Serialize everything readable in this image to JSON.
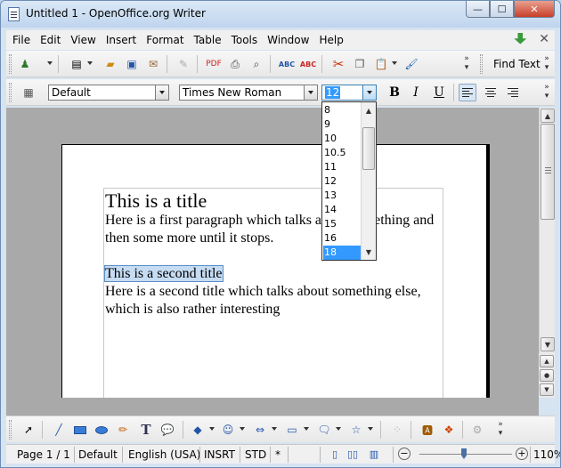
{
  "window": {
    "title": "Untitled 1 - OpenOffice.org Writer",
    "min_label": "—",
    "max_label": "☐",
    "close_label": "✕"
  },
  "menubar": {
    "items": [
      "File",
      "Edit",
      "View",
      "Insert",
      "Format",
      "Table",
      "Tools",
      "Window",
      "Help"
    ]
  },
  "toolbar": {
    "find_text": "Find Text",
    "icons": [
      "navigator-icon",
      "new-icon",
      "open-icon",
      "save-icon",
      "email-icon",
      "edit-file-icon",
      "export-pdf-icon",
      "print-icon",
      "page-preview-icon",
      "spellcheck-icon",
      "autospellcheck-icon",
      "cut-icon",
      "copy-icon",
      "paste-icon",
      "format-paintbrush-icon"
    ]
  },
  "formatting": {
    "style": "Default",
    "font": "Times New Roman",
    "size": "12",
    "bold": "B",
    "italic": "I",
    "underline": "U",
    "align": "left"
  },
  "font_size_list": {
    "options": [
      "8",
      "9",
      "10",
      "10.5",
      "11",
      "12",
      "13",
      "14",
      "15",
      "16",
      "18"
    ],
    "selected": "18"
  },
  "document": {
    "title1": "This is a title",
    "para1": "Here is a first paragraph which talks about something and then some more until it stops.",
    "title2": "This is a second title",
    "para2": "Here is a second title which talks about something else, which is also rather interesting"
  },
  "statusbar": {
    "page": "Page 1 / 1",
    "style": "Default",
    "language": "English (USA)",
    "insert_mode": "INSRT",
    "selection_mode": "STD",
    "modified": "*",
    "zoom": "110%"
  }
}
